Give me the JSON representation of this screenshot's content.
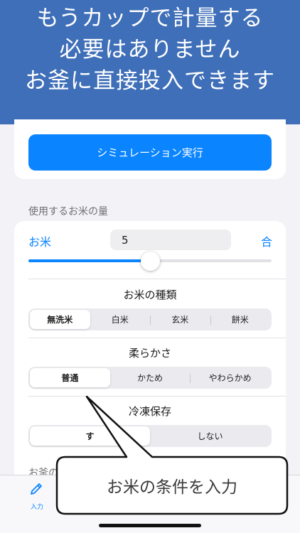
{
  "banner": {
    "lines": [
      "もうカップで計量する",
      "必要はありません",
      "お釜に直接投入できます"
    ]
  },
  "simulation": {
    "button_label": "シミュレーション実行"
  },
  "rice_section": {
    "header": "使用するお米の量",
    "rice_label": "お米",
    "amount_value": "5",
    "unit": "合",
    "slider_fraction": 0.5
  },
  "rice_type": {
    "title": "お米の種類",
    "options": [
      "無洗米",
      "白米",
      "玄米",
      "餅米"
    ],
    "selected": "無洗米"
  },
  "softness": {
    "title": "柔らかさ",
    "options": [
      "普通",
      "かため",
      "やわらかめ"
    ],
    "selected": "普通"
  },
  "freeze": {
    "title": "冷凍保存",
    "options": [
      "する",
      "しない"
    ],
    "selected": "する",
    "visible_first_label": "す"
  },
  "next_section": {
    "header": "お釜の"
  },
  "tabbar": {
    "input_label": "入力",
    "input_icon": "pencil-icon"
  },
  "callout": {
    "text": "お米の条件を入力"
  },
  "colors": {
    "accent": "#0a84ff",
    "banner": "#3f6fb8"
  }
}
